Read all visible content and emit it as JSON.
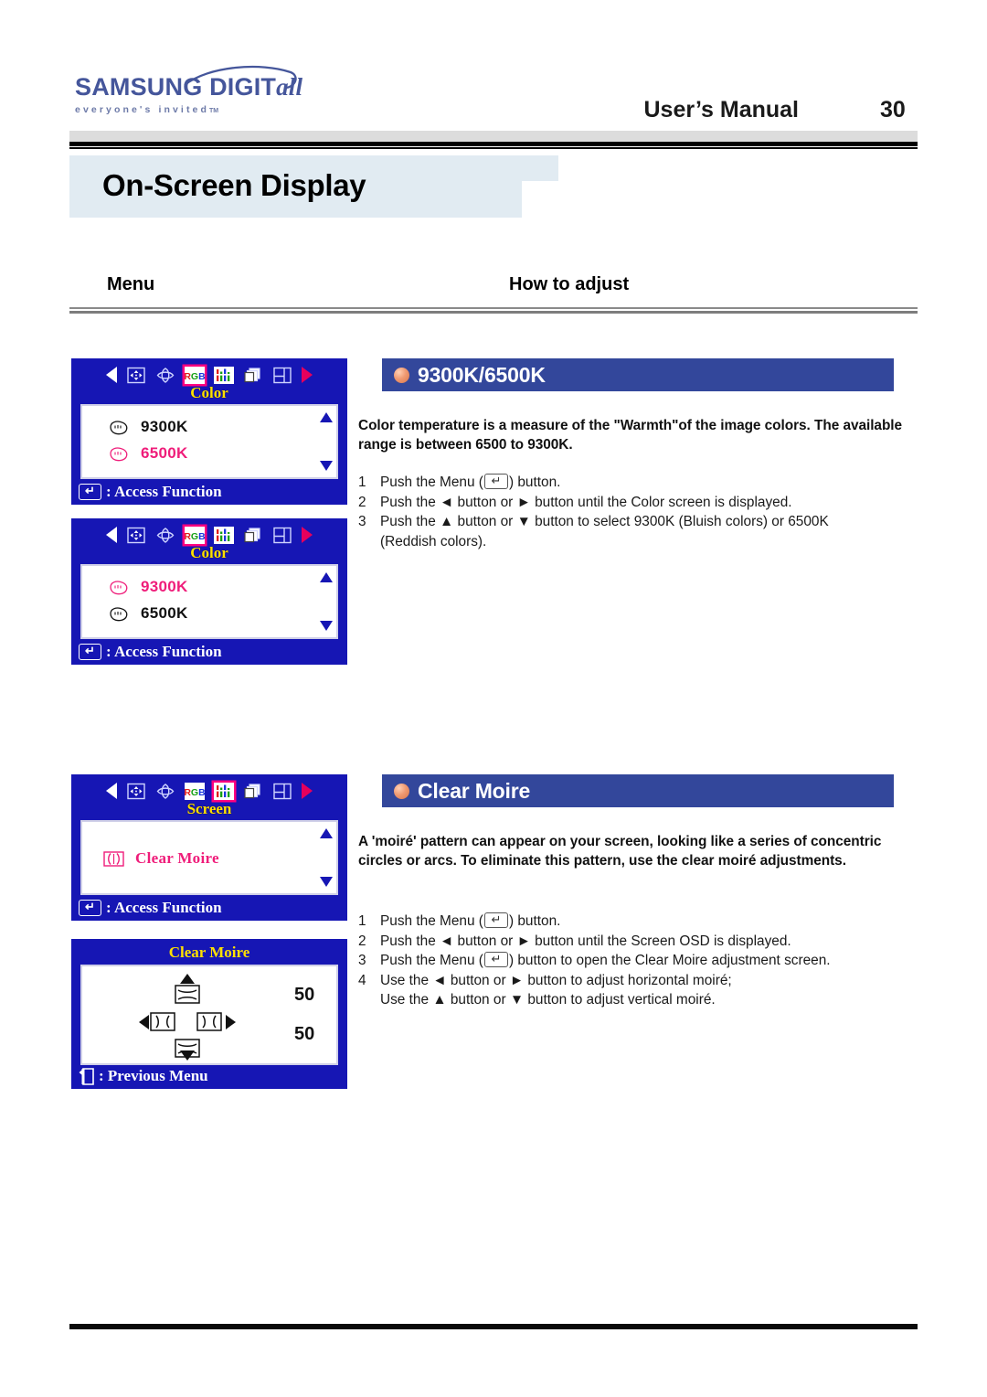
{
  "header": {
    "logo_main": "SAMSUNG DIGIT",
    "logo_main_italic": "all",
    "logo_tagline": "everyone's invited",
    "logo_tm": "TM",
    "manual_title": "User’s Manual",
    "page_number": "30"
  },
  "page_title": "On-Screen Display",
  "columns": {
    "menu": "Menu",
    "how_to_adjust": "How to adjust"
  },
  "sections": [
    {
      "id": "color-temp",
      "heading": "9300K/6500K",
      "description": "Color temperature is a measure of the \"Warmth\"of the image colors. The available range is between 6500 to 9300K.",
      "steps": [
        {
          "num": "1",
          "pre": "Push the Menu (",
          "post": ") button.",
          "has_menu_icon": true
        },
        {
          "num": "2",
          "text": "Push the ◄ button or ► button until the Color screen is displayed."
        },
        {
          "num": "3",
          "text": "Push the ▲ button or ▼ button to select 9300K (Bluish colors) or 6500K",
          "cont": "(Reddish colors)."
        }
      ]
    },
    {
      "id": "clear-moire",
      "heading": "Clear Moire",
      "description": "A 'moiré' pattern can appear on your screen, looking like a series of concentric circles or arcs. To eliminate this pattern, use the clear moiré adjustments.",
      "steps": [
        {
          "num": "1",
          "pre": "Push the Menu (",
          "post": ") button.",
          "has_menu_icon": true
        },
        {
          "num": "2",
          "text": "Push the ◄ button or ► button until the Screen OSD is displayed."
        },
        {
          "num": "3",
          "pre": "Push the Menu (",
          "post": ") button to open the Clear Moire adjustment screen.",
          "has_menu_icon": true
        },
        {
          "num": "4",
          "text": "Use the ◄ button or ► button to adjust horizontal moiré;",
          "cont": "Use the ▲ button or ▼ button to adjust vertical moiré."
        }
      ]
    }
  ],
  "osd_panels": [
    {
      "id": "osd-color-6500-selected",
      "menu_label": "Color",
      "footer": ": Access Function",
      "icons": [
        "arrow-left",
        "position-icon",
        "size-icon",
        "rgb-icon",
        "screen-icon",
        "copy-icon",
        "osd-icon",
        "arrow-right"
      ],
      "selected_icon": "rgb-icon",
      "rows": [
        {
          "label": "9300K",
          "state": "normal"
        },
        {
          "label": "6500K",
          "state": "selected"
        }
      ]
    },
    {
      "id": "osd-color-9300-selected",
      "menu_label": "Color",
      "footer": ": Access Function",
      "icons": [
        "arrow-left",
        "position-icon",
        "size-icon",
        "rgb-icon",
        "screen-icon",
        "copy-icon",
        "osd-icon",
        "arrow-right"
      ],
      "selected_icon": "rgb-icon",
      "rows": [
        {
          "label": "9300K",
          "state": "selected"
        },
        {
          "label": "6500K",
          "state": "normal"
        }
      ]
    },
    {
      "id": "osd-screen-clear-moire",
      "menu_label": "Screen",
      "footer": ": Access Function",
      "icons": [
        "arrow-left",
        "position-icon",
        "size-icon",
        "rgb-icon",
        "screen-icon",
        "copy-icon",
        "osd-icon",
        "arrow-right"
      ],
      "selected_icon": "screen-icon",
      "rows": [
        {
          "label": "Clear Moire",
          "state": "selected"
        }
      ]
    },
    {
      "id": "osd-clear-moire-adjust",
      "title": "Clear Moire",
      "footer": ": Previous Menu",
      "value_vertical": "50",
      "value_horizontal": "50"
    }
  ],
  "colors": {
    "osd_background": "#1616b4",
    "section_heading_bg": "#33479b",
    "selected_pink": "#ef1d7a",
    "menu_label_yellow": "#ffe000",
    "title_tab_bg": "#e1ebf2",
    "logo_blue": "#45569b"
  }
}
